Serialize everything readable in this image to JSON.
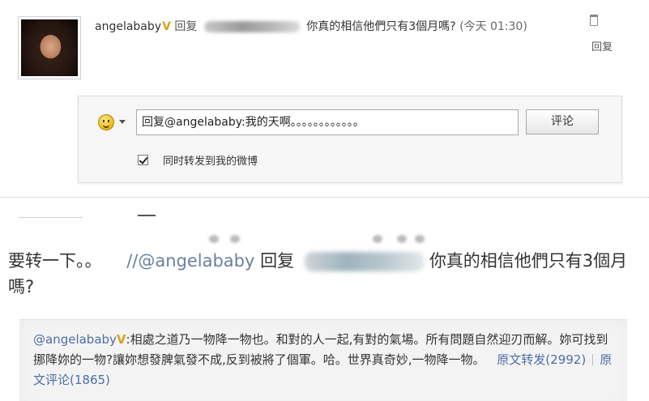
{
  "reply": {
    "username": "angelababy",
    "verified": "V",
    "reply_word": "回复",
    "reply_text": "你真的相信他們只有3個月嗎?",
    "time": "(今天 01:30)",
    "reply_link": "回复"
  },
  "comment_form": {
    "input_value": "回复@angelababy:我的天啊。。。。。。。。。。。。",
    "submit_label": "评论",
    "forward_label": "同时转发到我的微博",
    "forward_checked": true
  },
  "repost": {
    "text": "要转一下。。",
    "mention": "//@angelababy",
    "reply_word": "回复",
    "rest_text": "你真的相信他們只有3個月嗎?"
  },
  "quote": {
    "author": "@angelababy",
    "verified": "V",
    "body": ":相處之道乃一物降一物也。和對的人一起,有對的氣場。所有問題自然迎刃而解。妳可找到挪降妳的一物?讓妳想發脾氣發不成,反到被將了個軍。哈。世界真奇妙,一物降一物。",
    "forward_link": "原文转发(2992)",
    "comment_link": "原文评论(1865)"
  }
}
